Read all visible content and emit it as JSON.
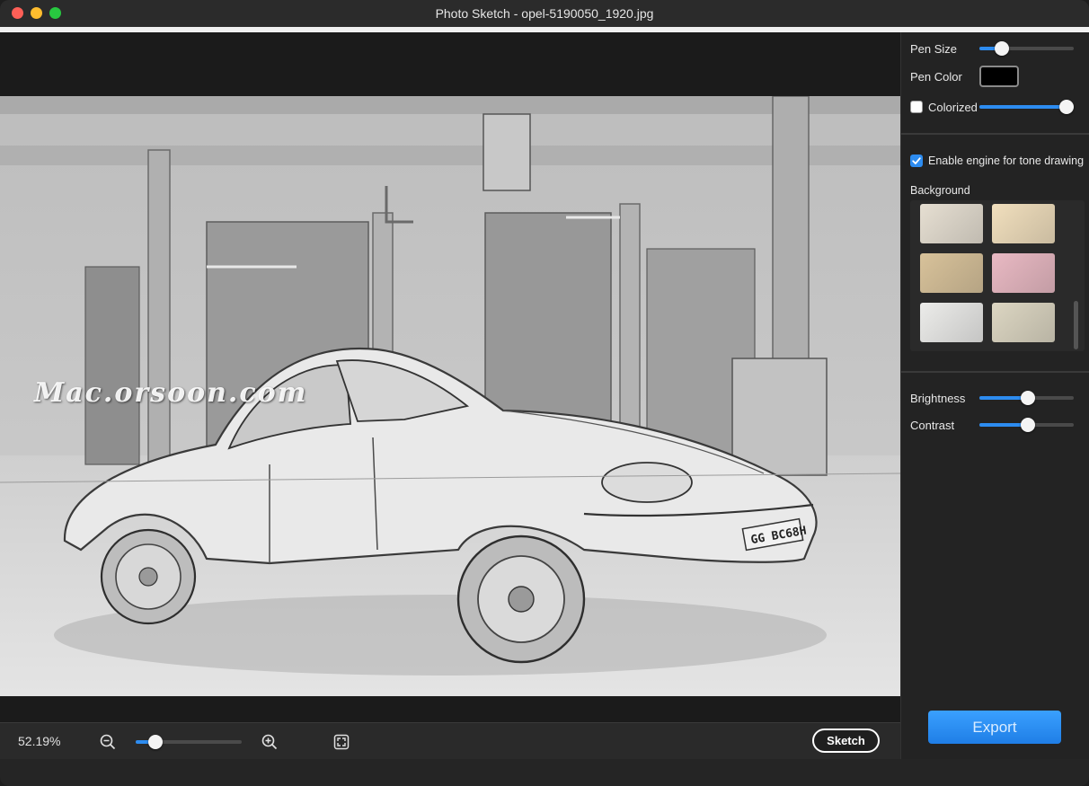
{
  "window": {
    "title": "Photo Sketch - opel-5190050_1920.jpg"
  },
  "canvas": {
    "watermark": "Mac.orsoon.com",
    "license_plate": "GG BC68H"
  },
  "bottom_bar": {
    "zoom_percent": "52.19%",
    "zoom_level_fraction": 0.14,
    "sketch_label": "Sketch"
  },
  "panel": {
    "pen_size_label": "Pen Size",
    "pen_size_fraction": 0.19,
    "pen_color_label": "Pen Color",
    "pen_color": "#000000",
    "colorized_label": "Colorized",
    "colorized_checked": false,
    "colorized_fraction": 1.0,
    "tone_engine_label": "Enable engine for tone drawing",
    "tone_engine_checked": true,
    "background_label": "Background",
    "background_swatches": [
      "#e6dfd2",
      "#f1dfbd",
      "#d8c29a",
      "#e9b9c3",
      "#ececea",
      "#dcd6c2"
    ],
    "brightness_label": "Brightness",
    "brightness_fraction": 0.52,
    "contrast_label": "Contrast",
    "contrast_fraction": 0.52,
    "export_label": "Export"
  },
  "colors": {
    "accent": "#2d8cf0",
    "panel_bg": "#232323",
    "window_bg": "#1e1e1e"
  }
}
